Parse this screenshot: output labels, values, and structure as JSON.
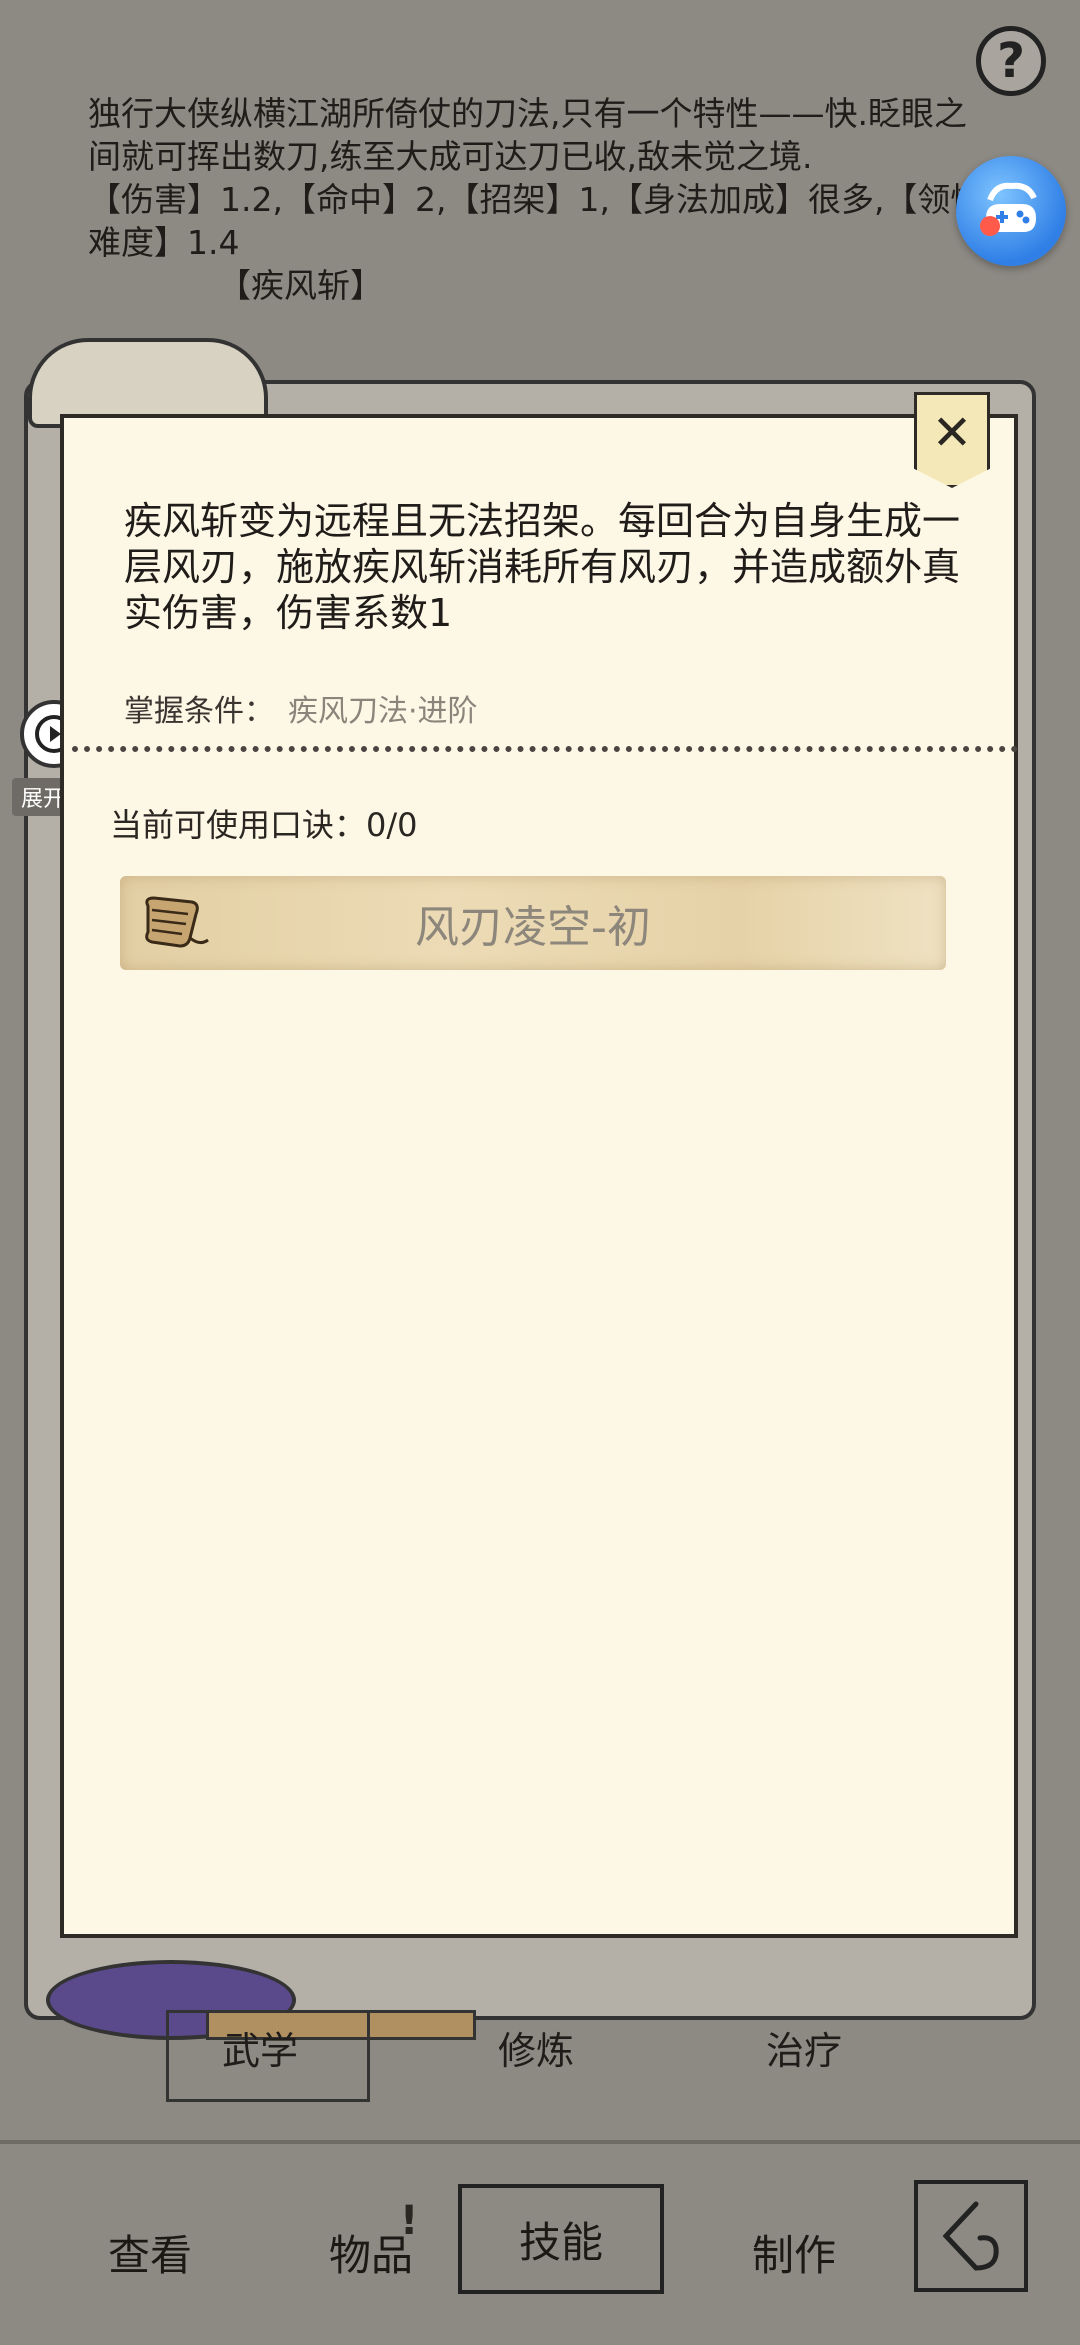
{
  "background": {
    "help_label": "?",
    "description": "独行大侠纵横江湖所倚仗的刀法,只有一个特性——快.眨眼之间就可挥出数刀,练至大成可达刀已收,敌未觉之境.",
    "stats": "【伤害】1.2,【命中】2,【招架】1,【身法加成】很多,【领悟难度】1.4",
    "partial_skill": "【疾风斩】"
  },
  "subtabs": {
    "martial": "武学",
    "training": "修炼",
    "healing": "治疗"
  },
  "nav": {
    "view": "查看",
    "items": "物品",
    "items_badge": "!",
    "skills": "技能",
    "craft": "制作"
  },
  "video_widget": {
    "expand_label": "展开"
  },
  "panel": {
    "effect": "疾风斩变为远程且无法招架。每回合为自身生成一层风刃，施放疾风斩消耗所有风刃，并造成额外真实伤害，伤害系数1",
    "mastery_label": "掌握条件：",
    "mastery_value": "疾风刀法·进阶",
    "current_label": "当前可使用口诀：",
    "current_value": "0/0",
    "skill_item": "风刃凌空-初"
  },
  "colors": {
    "panel_bg": "#fdf8e6",
    "screen_bg": "#8d8a84",
    "skill_row": "#e6d2a8"
  }
}
